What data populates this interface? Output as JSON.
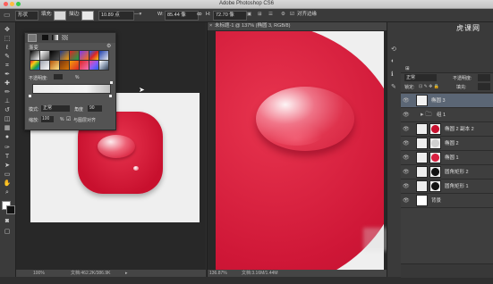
{
  "window": {
    "title": "Adobe Photoshop CS6"
  },
  "options_bar": {
    "shape_mode": "形状",
    "fill_label": "填充:",
    "stroke_label": "描边:",
    "stroke_width": "10.89 点",
    "w_label": "W:",
    "w_value": "85.44 像",
    "link_icon": "ꝏ",
    "h_label": "H:",
    "h_value": "72.70 像",
    "align_edges": "对齐边缘",
    "fill_color": "#d9d9d9",
    "stroke_color": "#e8e8e8"
  },
  "gradient_panel": {
    "title": "渐变",
    "opacity_label": "不透明度:",
    "percent": "%",
    "pattern_label": "图案",
    "mode_label": "模式:",
    "mode_value": "正常",
    "angle_label": "角度",
    "angle_value": "90",
    "scale_label": "缩放:",
    "scale_value": "100",
    "align_label": "与图层对齐",
    "swatches": [
      "linear-gradient(135deg,#000,#fff)",
      "linear-gradient(135deg,#fff,rgba(255,255,255,0))",
      "linear-gradient(135deg,#000,rgba(0,0,0,0))",
      "linear-gradient(135deg,#1e3a8a,#f59e0b)",
      "linear-gradient(135deg,#dc2626,#16a34a)",
      "linear-gradient(135deg,#7c3aed,#f97316)",
      "linear-gradient(135deg,#2563eb,#dc2626,#facc15)",
      "linear-gradient(135deg,#1e40af,#e5e7eb)",
      "linear-gradient(135deg,#dc2626,#facc15,#16a34a,#2563eb)",
      "linear-gradient(135deg,#9ca3af,#fff)",
      "linear-gradient(135deg,#b45309,#fde68a)",
      "linear-gradient(135deg,#78350f,#d97706)",
      "linear-gradient(135deg,#f59e0b,#dc2626)",
      "linear-gradient(135deg,#dc2626,#f472b6)",
      "linear-gradient(135deg,#ec4899,#8b5cf6,#2563eb)",
      "linear-gradient(135deg,#fff,#94a3b8,#334155)"
    ]
  },
  "doc_left": {
    "zoom": "100%",
    "doc_info": "文档:462.2K/386.9K"
  },
  "doc_right": {
    "tab_title": "未标题-1 @ 137% (椭圆 3, RGB/8)",
    "zoom": "136.87%",
    "doc_info": "文档:3.16M/1.44M"
  },
  "layers_panel": {
    "blend_mode": "正常",
    "opacity_label": "不透明度:",
    "lock_label": "锁定:",
    "fill_label": "填充:",
    "layers": [
      {
        "name": "椭圆 3",
        "selected": true
      },
      {
        "name": "组 1",
        "selected": false
      },
      {
        "name": "椭圆 2 副本 2",
        "selected": false
      },
      {
        "name": "椭圆 2",
        "selected": false
      },
      {
        "name": "椭圆 1",
        "selected": false
      },
      {
        "name": "圆角矩形 2",
        "selected": false
      },
      {
        "name": "圆角矩形 1",
        "selected": false
      },
      {
        "name": "背景",
        "selected": false
      }
    ]
  },
  "watermark": {
    "text": "虎课网"
  },
  "colors": {
    "accent_red": "#d81f3f",
    "canvas_bg": "#efefef"
  }
}
